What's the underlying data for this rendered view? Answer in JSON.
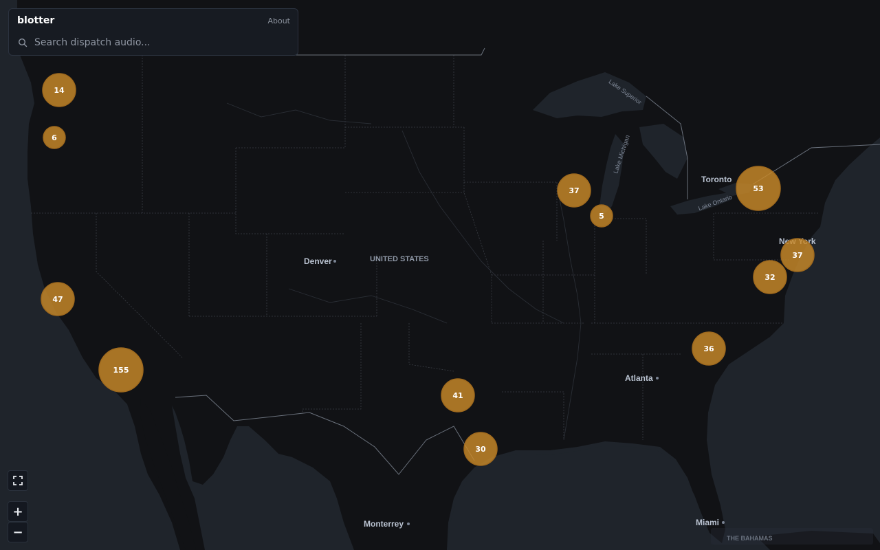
{
  "app": {
    "title": "blotter",
    "about_label": "About"
  },
  "search": {
    "placeholder": "Search dispatch audio..."
  },
  "map": {
    "land_color": "#111215",
    "water_color": "#1f242b",
    "cluster_color": "#c98a2a",
    "labels": {
      "denver": "Denver",
      "usa": "UNITED STATES",
      "toronto": "Toronto",
      "new_york": "New York",
      "atlanta": "Atlanta",
      "miami": "Miami",
      "monterrey": "Monterrey",
      "bahamas": "THE BAHAMAS",
      "lake_michigan": "Lake Michigan",
      "lake_superior": "Lake Superior",
      "lake_ontario": "Lake Ontario"
    },
    "clusters": [
      {
        "id": "seattle",
        "count": "14"
      },
      {
        "id": "portland",
        "count": "6"
      },
      {
        "id": "bay-area",
        "count": "47"
      },
      {
        "id": "los-angeles",
        "count": "155"
      },
      {
        "id": "madison",
        "count": "37"
      },
      {
        "id": "chicago",
        "count": "5"
      },
      {
        "id": "buffalo",
        "count": "53"
      },
      {
        "id": "new-york",
        "count": "37"
      },
      {
        "id": "washington",
        "count": "32"
      },
      {
        "id": "charlotte",
        "count": "36"
      },
      {
        "id": "dallas",
        "count": "41"
      },
      {
        "id": "houston",
        "count": "30"
      }
    ]
  },
  "controls": {
    "fullscreen_icon": "fullscreen-icon",
    "zoom_in_label": "+",
    "zoom_out_label": "−"
  }
}
